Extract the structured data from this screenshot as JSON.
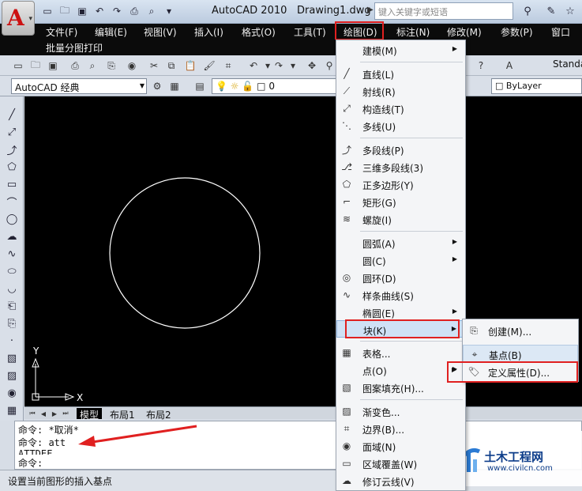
{
  "titlebar": {
    "app": "AutoCAD 2010",
    "doc": "Drawing1.dwg",
    "search_placeholder": "键入关键字或短语",
    "app_logo_letter": "A",
    "qat_icons": [
      "new-icon",
      "open-icon",
      "save-icon",
      "undo-icon",
      "redo-icon",
      "plot-icon",
      "print-preview-icon",
      "dropdown-icon"
    ]
  },
  "menubar": {
    "items": [
      "文件(F)",
      "编辑(E)",
      "视图(V)",
      "插入(I)",
      "格式(O)",
      "工具(T)",
      "绘图(D)",
      "标注(N)",
      "修改(M)",
      "参数(P)",
      "窗口"
    ],
    "ribbon_title": "批量分图打印"
  },
  "toolbar": {
    "workspace": "AutoCAD 经典",
    "layer": "0",
    "linetype": "ByLayer",
    "standard": "Standa"
  },
  "draw_menu": {
    "items": [
      {
        "label": "建模(M)",
        "icon": "",
        "submenu": true
      },
      {
        "label": "直线(L)",
        "icon": "line-icon"
      },
      {
        "label": "射线(R)",
        "icon": "ray-icon"
      },
      {
        "label": "构造线(T)",
        "icon": "xline-icon"
      },
      {
        "label": "多线(U)",
        "icon": "mline-icon"
      },
      {
        "label": "多段线(P)",
        "icon": "polyline-icon"
      },
      {
        "label": "三维多段线(3)",
        "icon": "3dpoly-icon"
      },
      {
        "label": "正多边形(Y)",
        "icon": "polygon-icon"
      },
      {
        "label": "矩形(G)",
        "icon": "rectangle-icon"
      },
      {
        "label": "螺旋(I)",
        "icon": "helix-icon"
      },
      {
        "label": "圆弧(A)",
        "icon": "",
        "submenu": true
      },
      {
        "label": "圆(C)",
        "icon": "",
        "submenu": true
      },
      {
        "label": "圆环(D)",
        "icon": "donut-icon"
      },
      {
        "label": "样条曲线(S)",
        "icon": "spline-icon"
      },
      {
        "label": "椭圆(E)",
        "icon": "",
        "submenu": true
      },
      {
        "label": "块(K)",
        "icon": "",
        "submenu": true
      },
      {
        "label": "表格...",
        "icon": "table-icon"
      },
      {
        "label": "点(O)",
        "icon": "",
        "submenu": true
      },
      {
        "label": "图案填充(H)...",
        "icon": "hatch-icon"
      },
      {
        "label": "渐变色...",
        "icon": "gradient-icon"
      },
      {
        "label": "边界(B)...",
        "icon": "boundary-icon"
      },
      {
        "label": "面域(N)",
        "icon": "region-icon"
      },
      {
        "label": "区域覆盖(W)",
        "icon": "wipeout-icon"
      },
      {
        "label": "修订云线(V)",
        "icon": "revcloud-icon"
      }
    ]
  },
  "block_submenu": {
    "items": [
      {
        "label": "创建(M)...",
        "icon": "block-create-icon"
      },
      {
        "label": "基点(B)",
        "icon": "base-point-icon"
      },
      {
        "label": "定义属性(D)...",
        "icon": "define-attribute-icon"
      }
    ]
  },
  "canvas": {
    "ucs_x": "X",
    "ucs_y": "Y",
    "tabs": [
      "模型",
      "布局1",
      "布局2"
    ]
  },
  "command": {
    "lines": [
      "命令: *取消*",
      "命令: att",
      "ATTDEF",
      "命令:"
    ]
  },
  "status": {
    "text": "设置当前图形的插入基点"
  },
  "watermark": {
    "title": "土木工程网",
    "url": "www.civilcn.com"
  },
  "colors": {
    "highlight_box": "#e02020",
    "menubar_bg": "#0b0b0b",
    "canvas_bg": "#000000"
  }
}
